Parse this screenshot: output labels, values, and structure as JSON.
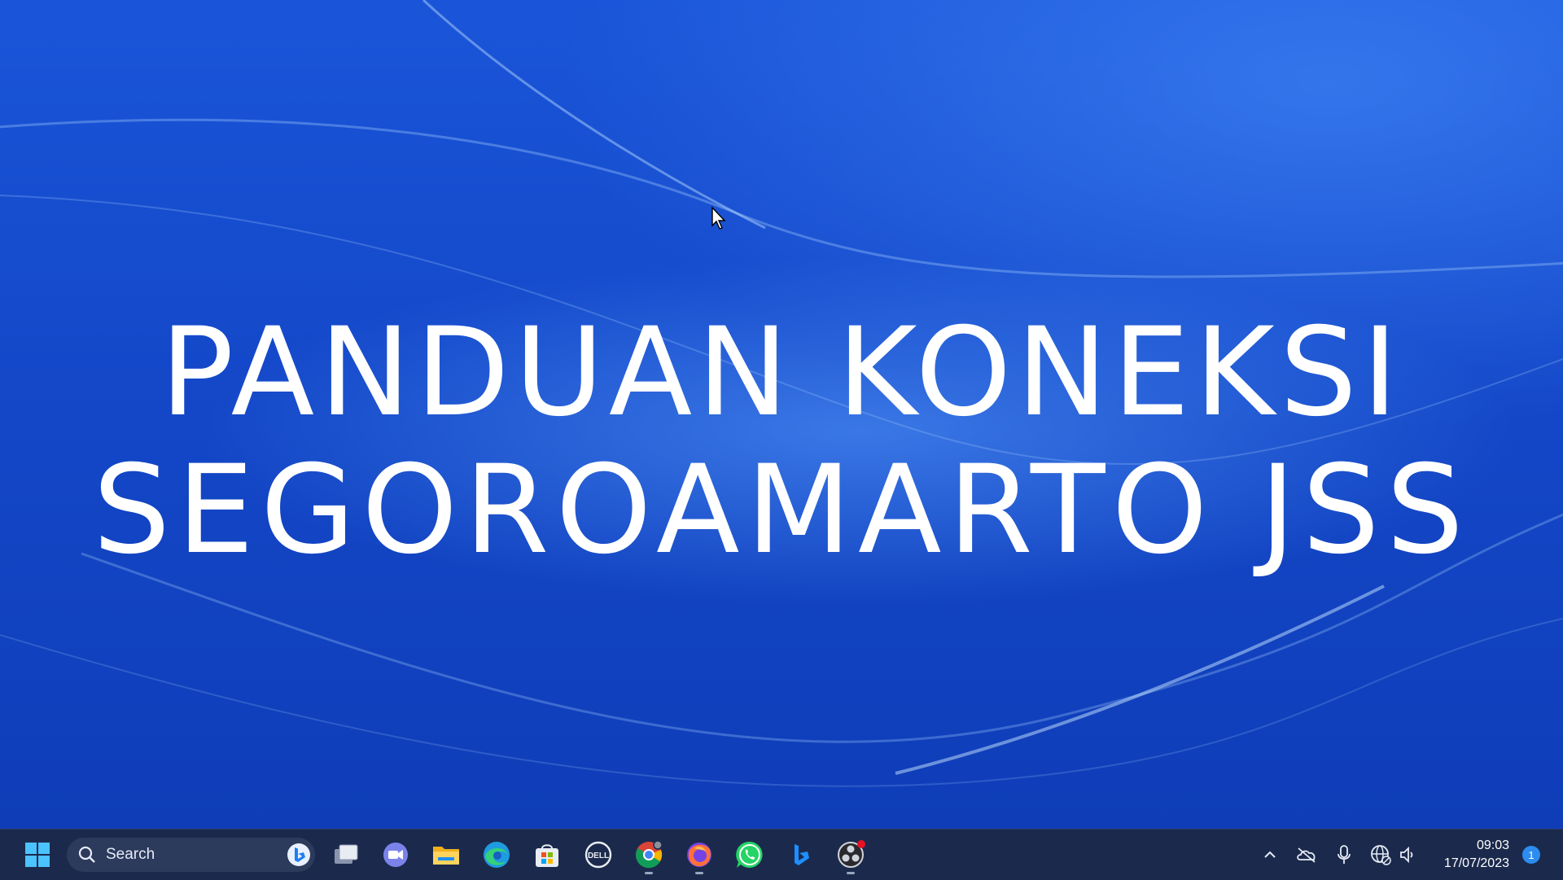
{
  "desktop": {
    "title_line1": "PANDUAN KONEKSI",
    "title_line2": "SEGOROAMARTO JSS",
    "wallpaper_colors": {
      "base": "#1448c9",
      "highlight": "#5aa0ff"
    }
  },
  "taskbar": {
    "search": {
      "label": "Search"
    },
    "pinned_apps": [
      {
        "name": "task-view-icon"
      },
      {
        "name": "teams-chat-icon"
      },
      {
        "name": "file-explorer-icon"
      },
      {
        "name": "edge-icon"
      },
      {
        "name": "microsoft-store-icon"
      },
      {
        "name": "dell-icon",
        "label": "DELL"
      },
      {
        "name": "chrome-icon"
      },
      {
        "name": "firefox-icon"
      },
      {
        "name": "whatsapp-icon"
      },
      {
        "name": "bing-icon"
      },
      {
        "name": "obs-icon"
      }
    ],
    "tray": {
      "icons": [
        "chevron-up-icon",
        "onedrive-icon",
        "microphone-icon",
        "network-icon",
        "volume-icon"
      ],
      "time": "09:03",
      "date": "17/07/2023",
      "notification_count": "1"
    }
  }
}
